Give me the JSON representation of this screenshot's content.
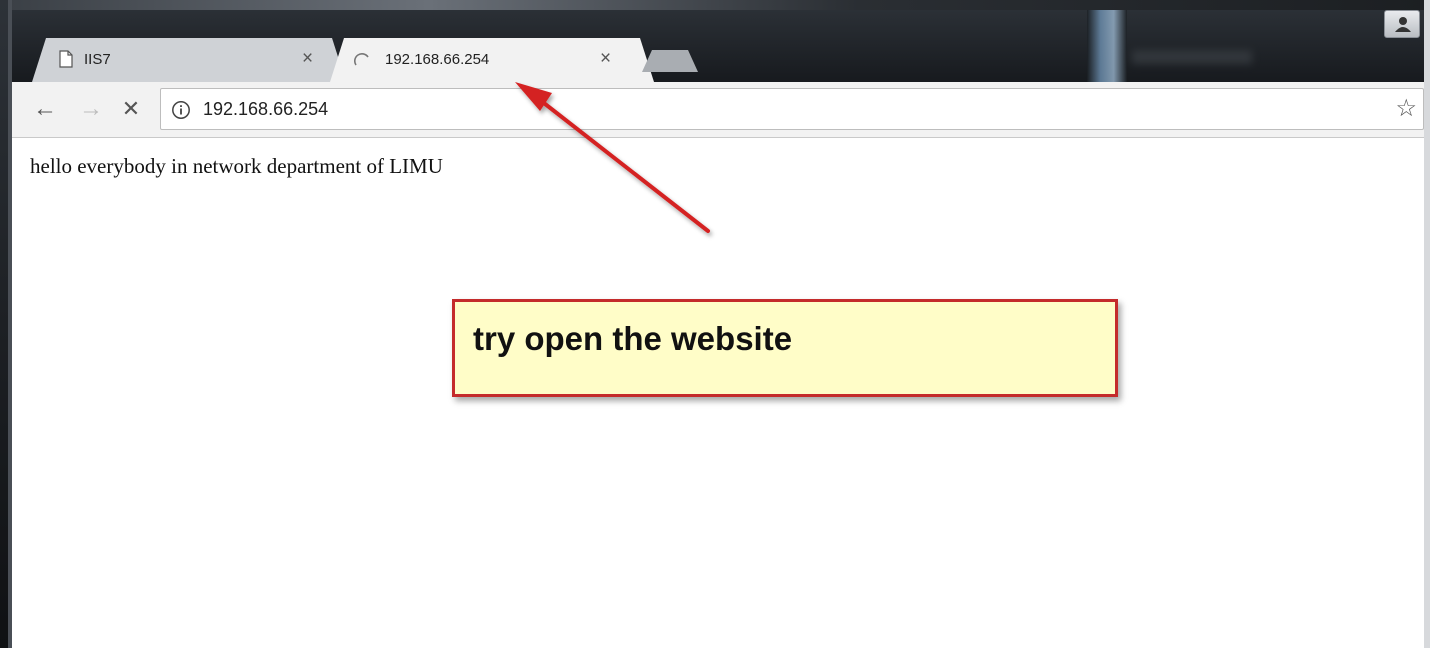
{
  "browser": {
    "tabs": [
      {
        "title": "IIS7",
        "icon": "page-icon",
        "active": false
      },
      {
        "title": "192.168.66.254",
        "icon": "loading-spinner-icon",
        "active": true
      }
    ],
    "close_glyph": "×",
    "nav": {
      "back": "←",
      "forward": "→",
      "stop": "✕"
    },
    "omnibox": {
      "url": "192.168.66.254",
      "bookmark_glyph": "☆"
    }
  },
  "page": {
    "body_text": "hello everybody in network department of LIMU"
  },
  "annotation": {
    "callout_text": "try open the website",
    "border_color": "#c42b2b",
    "fill_color": "#fffdc8",
    "arrow_color": "#d42020"
  }
}
